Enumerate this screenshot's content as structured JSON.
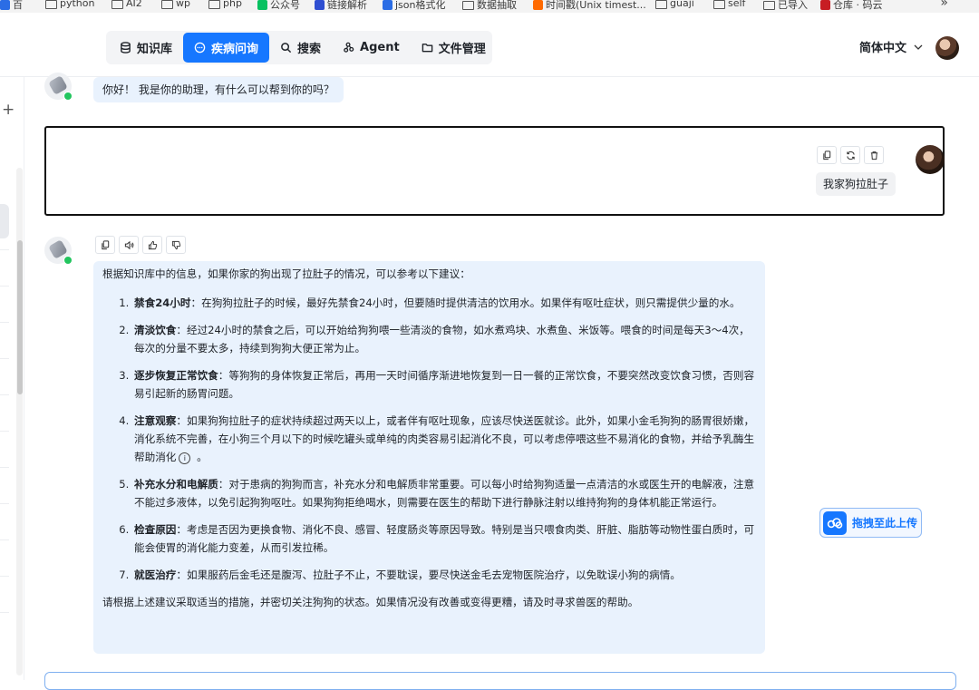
{
  "bookmarks": [
    {
      "label": "百",
      "type": "badge",
      "color": "#2b6de5"
    },
    {
      "label": "python",
      "type": "folder"
    },
    {
      "label": "AI2",
      "type": "folder"
    },
    {
      "label": "wp",
      "type": "folder"
    },
    {
      "label": "php",
      "type": "folder"
    },
    {
      "label": "公众号",
      "type": "badge",
      "color": "#07c160"
    },
    {
      "label": "链接解析",
      "type": "badge",
      "color": "#2f4fd1"
    },
    {
      "label": "json格式化",
      "type": "badge",
      "color": "#2b6de5"
    },
    {
      "label": "数据抽取",
      "type": "folder"
    },
    {
      "label": "时间戳(Unix timest...",
      "type": "badge",
      "color": "#ff6a00"
    },
    {
      "label": "guaji",
      "type": "folder"
    },
    {
      "label": "self",
      "type": "folder"
    },
    {
      "label": "已导入",
      "type": "folder"
    },
    {
      "label": "仓库 · 码云",
      "type": "badge",
      "color": "#c71d23"
    }
  ],
  "bookmarks_more": "»",
  "nav": {
    "items": [
      {
        "label": "知识库",
        "icon": "database-icon",
        "active": false
      },
      {
        "label": "疾病问询",
        "icon": "chat-icon",
        "active": true
      },
      {
        "label": "搜索",
        "icon": "search-icon",
        "active": false
      },
      {
        "label": "Agent",
        "icon": "agent-icon",
        "active": false
      },
      {
        "label": "文件管理",
        "icon": "folder-icon",
        "active": false
      }
    ],
    "language": "简体中文",
    "accent": "#1677ff"
  },
  "sidebar": {
    "new_label": "+"
  },
  "chat": {
    "greeting": "你好！ 我是你的助理，有什么可以帮到你的吗？",
    "user_message": "我家狗拉肚子",
    "answer_intro": "根据知识库中的信息，如果你家的狗出现了拉肚子的情况，可以参考以下建议：",
    "answer_items": [
      {
        "title": "禁食24小时",
        "text": "：在狗狗拉肚子的时候，最好先禁食24小时，但要随时提供清洁的饮用水。如果伴有呕吐症状，则只需提供少量的水。"
      },
      {
        "title": "清淡饮食",
        "text": "：经过24小时的禁食之后，可以开始给狗狗喂一些清淡的食物，如水煮鸡块、水煮鱼、米饭等。喂食的时间是每天3～4次，每次的分量不要太多，持续到狗狗大便正常为止。"
      },
      {
        "title": "逐步恢复正常饮食",
        "text": "：等狗狗的身体恢复正常后，再用一天时间循序渐进地恢复到一日一餐的正常饮食，不要突然改变饮食习惯，否则容易引起新的肠胃问题。"
      },
      {
        "title": "注意观察",
        "text": "：如果狗狗拉肚子的症状持续超过两天以上，或者伴有呕吐现象，应该尽快送医就诊。此外，如果小金毛狗狗的肠胃很娇嫩，消化系统不完善，在小狗三个月以下的时候吃罐头或单纯的肉类容易引起消化不良，可以考虑停喂这些不易消化的食物，并给予乳酶生帮助消化",
        "info": "i",
        "suffix": " 。"
      },
      {
        "title": "补充水分和电解质",
        "text": "：对于患病的狗狗而言，补充水分和电解质非常重要。可以每小时给狗狗适量一点清洁的水或医生开的电解液，注意不能过多液体，以免引起狗狗呕吐。如果狗狗拒绝喝水，则需要在医生的帮助下进行静脉注射以维持狗狗的身体机能正常运行。"
      },
      {
        "title": "检查原因",
        "text": "：考虑是否因为更换食物、消化不良、感冒、轻度肠炎等原因导致。特别是当只喂食肉类、肝脏、脂肪等动物性蛋白质时，可能会使胃的消化能力变差，从而引发拉稀。"
      },
      {
        "title": "就医治疗",
        "text": "：如果服药后金毛还是腹泻、拉肚子不止，不要耽误，要尽快送金毛去宠物医院治疗，以免耽误小狗的病情。"
      }
    ],
    "answer_outro": "请根据上述建议采取适当的措施，并密切关注狗狗的状态。如果情况没有改善或变得更糟，请及时寻求兽医的帮助。",
    "upload_label": "拖拽至此上传"
  }
}
